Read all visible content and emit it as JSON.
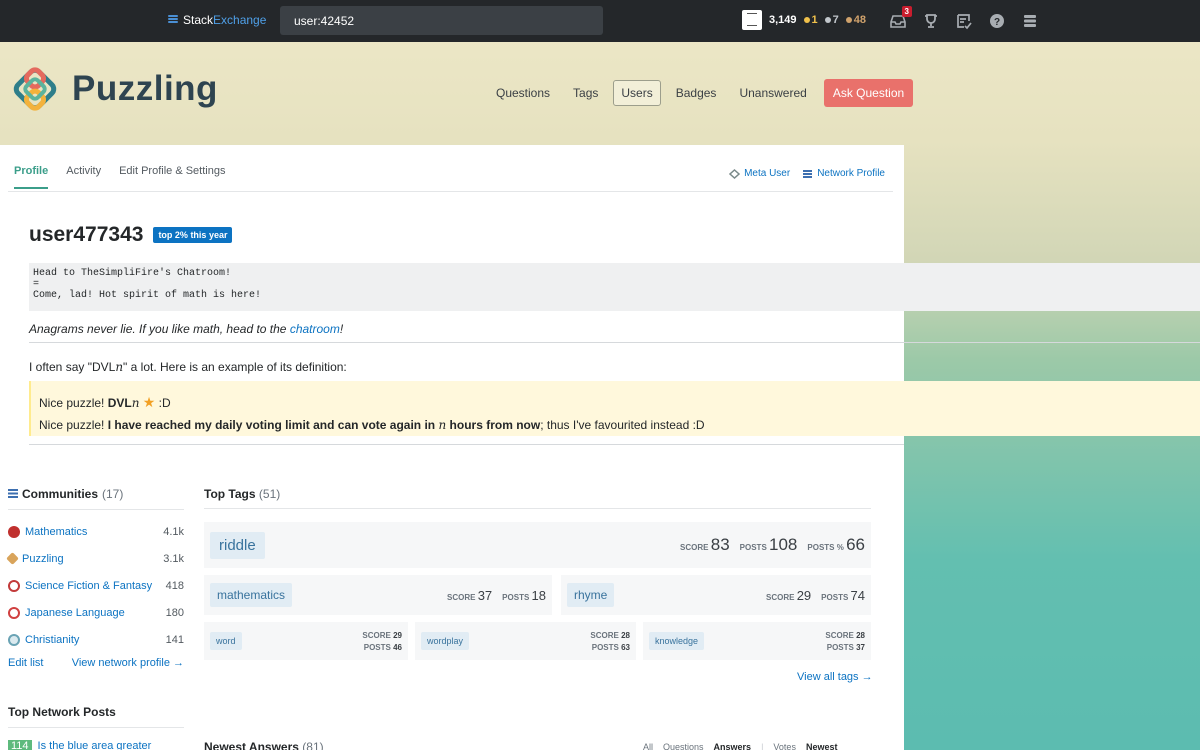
{
  "topbar": {
    "brand_stack": "Stack",
    "brand_exchange": "Exchange",
    "search_value": "user:42452",
    "reputation": "3,149",
    "gold": "1",
    "silver": "7",
    "bronze": "48",
    "inbox_count": "3",
    "icons": [
      "inbox-icon",
      "achievements-icon",
      "review-icon",
      "help-icon",
      "site-switcher-icon"
    ]
  },
  "site": {
    "name": "Puzzling",
    "nav": [
      "Questions",
      "Tags",
      "Users",
      "Badges",
      "Unanswered"
    ],
    "ask": "Ask Question",
    "colors": {
      "accent": "#3b9e8a",
      "ask": "#e9716b",
      "link": "#0c73c2"
    }
  },
  "profile": {
    "tabs": [
      "Profile",
      "Activity",
      "Edit Profile & Settings"
    ],
    "meta_user": "Meta User",
    "network_profile": "Network Profile",
    "username": "user477343",
    "badge": "top 2% this year",
    "pre": "Head to TheSimpliFire's Chatroom!\n=\nCome, lad! Hot spirit of math is here!",
    "quote_text": "Anagrams never lie. If you like math, head to the ",
    "quote_link": "chatroom",
    "quote_end": "!",
    "say_text": "I often say \"DVL",
    "say_n": "n",
    "say_end": "\" a lot. Here is an example of its definition:",
    "bq_line1_a": "Nice puzzle! ",
    "bq_line1_b": "DVL",
    "bq_line1_n": "n",
    "bq_line1_c": " :D",
    "bq_line2_a": "Nice puzzle! ",
    "bq_line2_b": "I have reached my daily voting limit and can vote again in ",
    "bq_line2_n": "n",
    "bq_line2_c": " hours from now",
    "bq_line2_d": "; thus I've favourited instead :D"
  },
  "communities": {
    "title": "Communities",
    "count": "(17)",
    "items": [
      {
        "name": "Mathematics",
        "rep": "4.1k",
        "color": "#c0302e"
      },
      {
        "name": "Puzzling",
        "rep": "3.1k",
        "color": "#d9a45b"
      },
      {
        "name": "Science Fiction & Fantasy",
        "rep": "418",
        "color": "#c23a3a"
      },
      {
        "name": "Japanese Language",
        "rep": "180",
        "color": "#d04040"
      },
      {
        "name": "Christianity",
        "rep": "141",
        "color": "#6aa3b4"
      }
    ],
    "edit": "Edit list",
    "view": "View network profile →"
  },
  "top_network_posts": {
    "title": "Top Network Posts",
    "first_score": "114",
    "first_title": "Is the blue area greater"
  },
  "top_tags": {
    "title": "Top Tags",
    "count": "(51)",
    "score_label": "SCORE",
    "posts_label": "POSTS",
    "pct_label": "POSTS %",
    "main": {
      "name": "riddle",
      "score": "83",
      "posts": "108",
      "pct": "66"
    },
    "second": [
      {
        "name": "mathematics",
        "score": "37",
        "posts": "18"
      },
      {
        "name": "rhyme",
        "score": "29",
        "posts": "74"
      }
    ],
    "third": [
      {
        "name": "word",
        "score": "29",
        "posts": "46"
      },
      {
        "name": "wordplay",
        "score": "28",
        "posts": "63"
      },
      {
        "name": "knowledge",
        "score": "28",
        "posts": "37"
      }
    ],
    "view_all": "View all tags →"
  },
  "newest": {
    "title": "Newest Answers",
    "count": "(81)",
    "tabs": [
      "All",
      "Questions",
      "Answers",
      "Votes",
      "Newest"
    ]
  }
}
